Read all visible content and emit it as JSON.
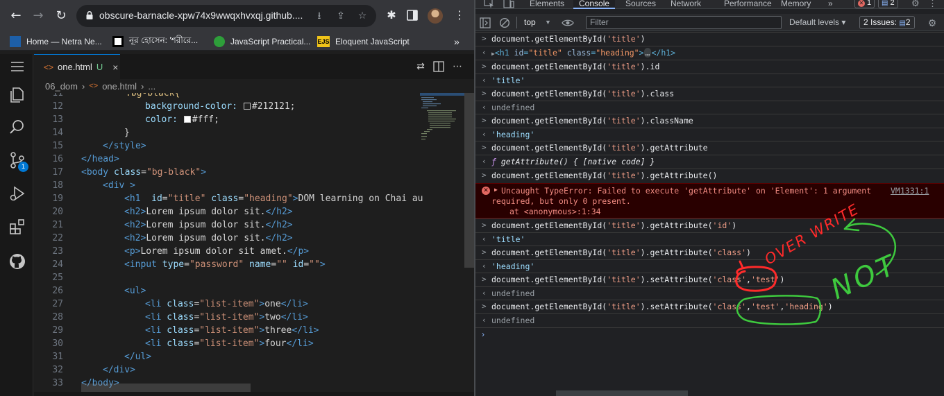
{
  "browser": {
    "url": "obscure-barnacle-xpw74x9wwqxhvxqj.github....",
    "bookmarks": [
      {
        "label": "Home — Netra Ne...",
        "icon": "netra-favicon"
      },
      {
        "label": "নূর হোসেন: 'শরীরে...",
        "icon": "news-favicon"
      },
      {
        "label": "JavaScript Practical...",
        "icon": "js-practical-favicon"
      },
      {
        "label": "Eloquent JavaScript",
        "icon": "ejs-favicon",
        "icon_text": "EJS"
      }
    ],
    "more_bookmarks": "»"
  },
  "vscode": {
    "tab": {
      "label": "one.html",
      "modified": "U",
      "close": "×"
    },
    "breadcrumb": {
      "folder": "06_dom",
      "sep": "›",
      "file": "one.html",
      "more": "..."
    },
    "activity_badge": "1",
    "line_numbers": [
      "11",
      "12",
      "13",
      "14",
      "15",
      "16",
      "17",
      "18",
      "19",
      "20",
      "21",
      "22",
      "23",
      "24",
      "25",
      "26",
      "27",
      "28",
      "29",
      "30",
      "31",
      "32",
      "33"
    ],
    "code": {
      "l11": ".bg-black{",
      "l12a": "background-color:",
      "l12b": "#212121;",
      "l13a": "color:",
      "l13b": "#fff;",
      "l14": "}",
      "l15a": "</",
      "l15b": "style",
      "l15c": ">",
      "l16a": "</",
      "l16b": "head",
      "l16c": ">",
      "l17a": "<",
      "l17b": "body",
      "l17c": " class",
      "l17d": "=",
      "l17e": "\"bg-black\"",
      "l17f": ">",
      "l18a": "<",
      "l18b": "div",
      "l18c": " >",
      "l19a": "<",
      "l19b": "h1",
      "l19c": "  id",
      "l19d": "=",
      "l19e": "\"title\"",
      "l19f": " class",
      "l19g": "=",
      "l19h": "\"heading\"",
      "l19i": ">",
      "l19j": "DOM learning on Chai au",
      "l20a": "<h2>",
      "l20b": "Lorem ipsum dolor sit.",
      "l20c": "</h2>",
      "l21a": "<h2>",
      "l21b": "Lorem ipsum dolor sit.",
      "l21c": "</h2>",
      "l22a": "<h2>",
      "l22b": "Lorem ipsum dolor sit.",
      "l22c": "</h2>",
      "l23a": "<p>",
      "l23b": "Lorem ipsum dolor sit amet.",
      "l23c": "</p>",
      "l24a": "<",
      "l24b": "input",
      "l24c": " type",
      "l24d": "=",
      "l24e": "\"password\"",
      "l24f": " name",
      "l24g": "=",
      "l24h": "\"\"",
      "l24i": " id",
      "l24j": "=",
      "l24k": "\"\"",
      "l24l": ">",
      "l26": "<ul>",
      "li_open": "<",
      "li_tag": "li",
      "li_class": " class",
      "li_eq": "=",
      "li_val": "\"list-item\"",
      "li_close": ">",
      "li_end": "</li>",
      "l27": "one",
      "l28": "two",
      "l29": "three",
      "l30": "four",
      "l31": "</ul>",
      "l32": "</div>",
      "l33": "</body>"
    }
  },
  "devtools": {
    "tabs": [
      "Elements",
      "Console",
      "Sources",
      "Network",
      "Performance",
      "Memory",
      "»"
    ],
    "error_count": "1",
    "issue_count": "2",
    "context": "top",
    "filter_placeholder": "Filter",
    "levels": "Default levels ▾",
    "issues": "2 Issues:",
    "issues_count": "2",
    "log": {
      "c1a": "document.",
      "c1b": "getElementById",
      "c1c": "(",
      "c1d": "'title'",
      "c1e": ")",
      "o1_open": "<",
      "o1_tag": "h1",
      "o1_id": " id",
      "o1_eq": "=",
      "o1_idv": "\"title\"",
      "o1_cl": " class",
      "o1_eq2": "=",
      "o1_clv": "\"heading\"",
      "o1_gt": ">",
      "o1_dots": "…",
      "o1_end": "</h1>",
      "c2_suffix": ".id",
      "o2": "'title'",
      "c3_suffix": ".class",
      "o3": "undefined",
      "c4_suffix": ".className",
      "o4": "'heading'",
      "c5_suffix": ".getAttribute",
      "o5_f": "ƒ",
      "o5_body": " getAttribute() { [native code] }",
      "c6_suffix": ".getAttribute()",
      "err1": "Uncaught TypeError: Failed to execute 'getAttribute' on 'Element': 1 argument",
      "err2": "required, but only 0 present.",
      "err3": "at <anonymous>:1:34",
      "err_src": "VM1331:1",
      "c7_suffix": ".getAttribute(",
      "c7_arg": "'id'",
      "c7_end": ")",
      "o7": "'title'",
      "c8_arg": "'class'",
      "o8": "'heading'",
      "c9_suffix": ".setAttribute(",
      "c9_arg1": "'class'",
      "c9_comma": ",",
      "c9_arg2": "'test'",
      "c9_end": ")",
      "o9": "undefined",
      "c10_arg3": "'heading'",
      "o10": "undefined"
    },
    "annotations": {
      "overwrite": "OVER WRITE",
      "not": "NOT"
    },
    "annotation_colors": {
      "red": "#ff2a2a",
      "green": "#3ec93e"
    }
  }
}
